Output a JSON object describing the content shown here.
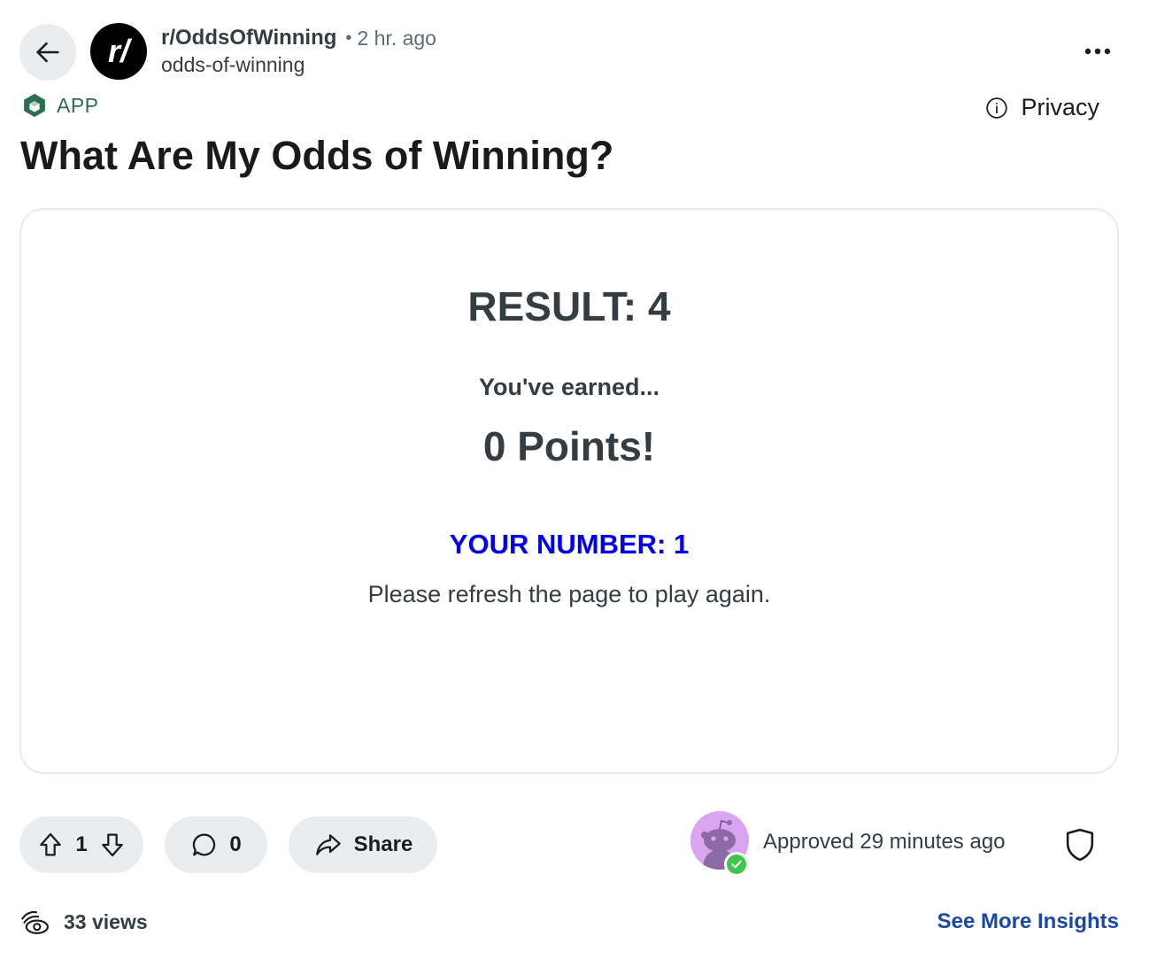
{
  "header": {
    "subreddit": "r/OddsOfWinning",
    "separator": "•",
    "time_ago": "2 hr. ago",
    "username": "odds-of-winning",
    "avatar_text": "r/"
  },
  "badge": {
    "label": "APP",
    "color": "#2b6f52"
  },
  "privacy": {
    "label": "Privacy"
  },
  "post": {
    "title": "What Are My Odds of Winning?"
  },
  "game": {
    "result": "RESULT: 4",
    "earned": "You've earned...",
    "points": "0 Points!",
    "your_number": "YOUR NUMBER: 1",
    "your_number_color": "#0000ee",
    "refresh_message": "Please refresh the page to play again."
  },
  "actions": {
    "vote_count": "1",
    "comment_count": "0",
    "share_label": "Share"
  },
  "moderation": {
    "approved_text": "Approved 29 minutes ago"
  },
  "footer": {
    "views": "33 views",
    "insights_label": "See More Insights",
    "insights_color": "#1c47a6"
  },
  "icons": [
    "arrow-left-icon",
    "more-horizontal-icon",
    "app-cube-icon",
    "info-icon",
    "upvote-icon",
    "downvote-icon",
    "comment-icon",
    "share-icon",
    "mod-shield-icon",
    "views-eye-icon",
    "check-icon"
  ]
}
